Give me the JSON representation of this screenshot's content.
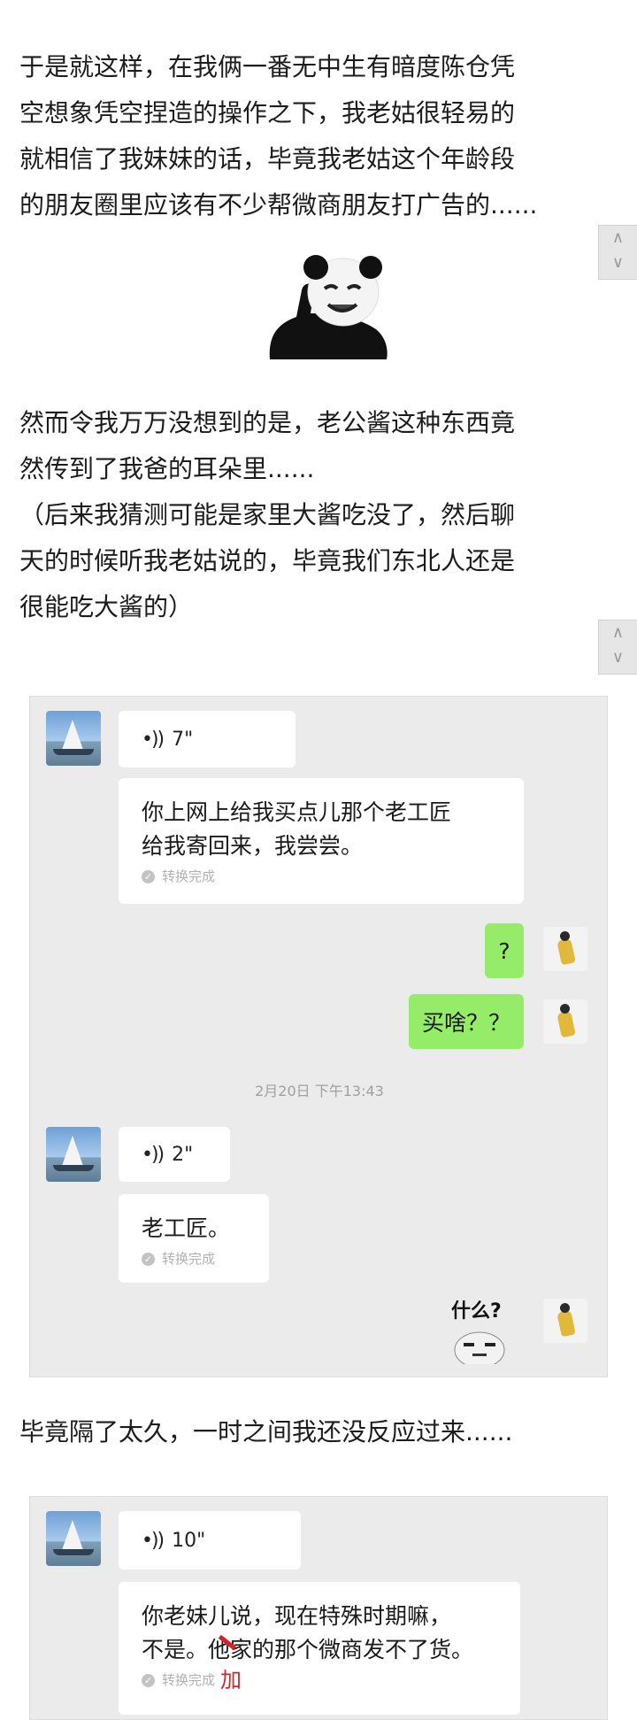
{
  "paragraphs": {
    "p1": [
      "于是就这样，在我俩一番无中生有暗度陈仓凭",
      "空想象凭空捏造的操作之下，我老姑很轻易的",
      "就相信了我妹妹的话，毕竟我老姑这个年龄段",
      "的朋友圈里应该有不少帮微商朋友打广告的......"
    ],
    "p2": [
      "然而令我万万没想到的是，老公酱这种东西竟",
      "然传到了我爸的耳朵里......",
      "（后来我猜测可能是家里大酱吃没了，然后聊",
      "天的时候听我老姑说的，毕竟我们东北人还是",
      "很能吃大酱的）"
    ],
    "p3": [
      "毕竟隔了太久，一时之间我还没反应过来......"
    ]
  },
  "side_tab": {
    "top_arrow": "∧",
    "bottom_arrow": "∨"
  },
  "chat1": {
    "voice1": {
      "duration": "7\""
    },
    "text1": {
      "lines": [
        "你上网上给我买点儿那个老工匠",
        "给我寄回来，我尝尝。"
      ],
      "status": "转换完成"
    },
    "reply1": "?",
    "reply2": "买啥？？",
    "timestamp": "2月20日 下午13:43",
    "voice2": {
      "duration": "2\""
    },
    "text2": {
      "lines": [
        "老工匠。"
      ],
      "status": "转换完成"
    },
    "sticker_caption": "什么?"
  },
  "chat2": {
    "voice": {
      "duration": "10\""
    },
    "text": {
      "lines": [
        "你老妹儿说，现在特殊时期嘛，",
        "不是。他家的那个微商发不了货。"
      ],
      "status": "转换完成",
      "correction": "加"
    }
  },
  "colors": {
    "green_bubble": "#95ec69",
    "chat_bg": "#ebebeb",
    "correction_red": "#d8222a"
  }
}
